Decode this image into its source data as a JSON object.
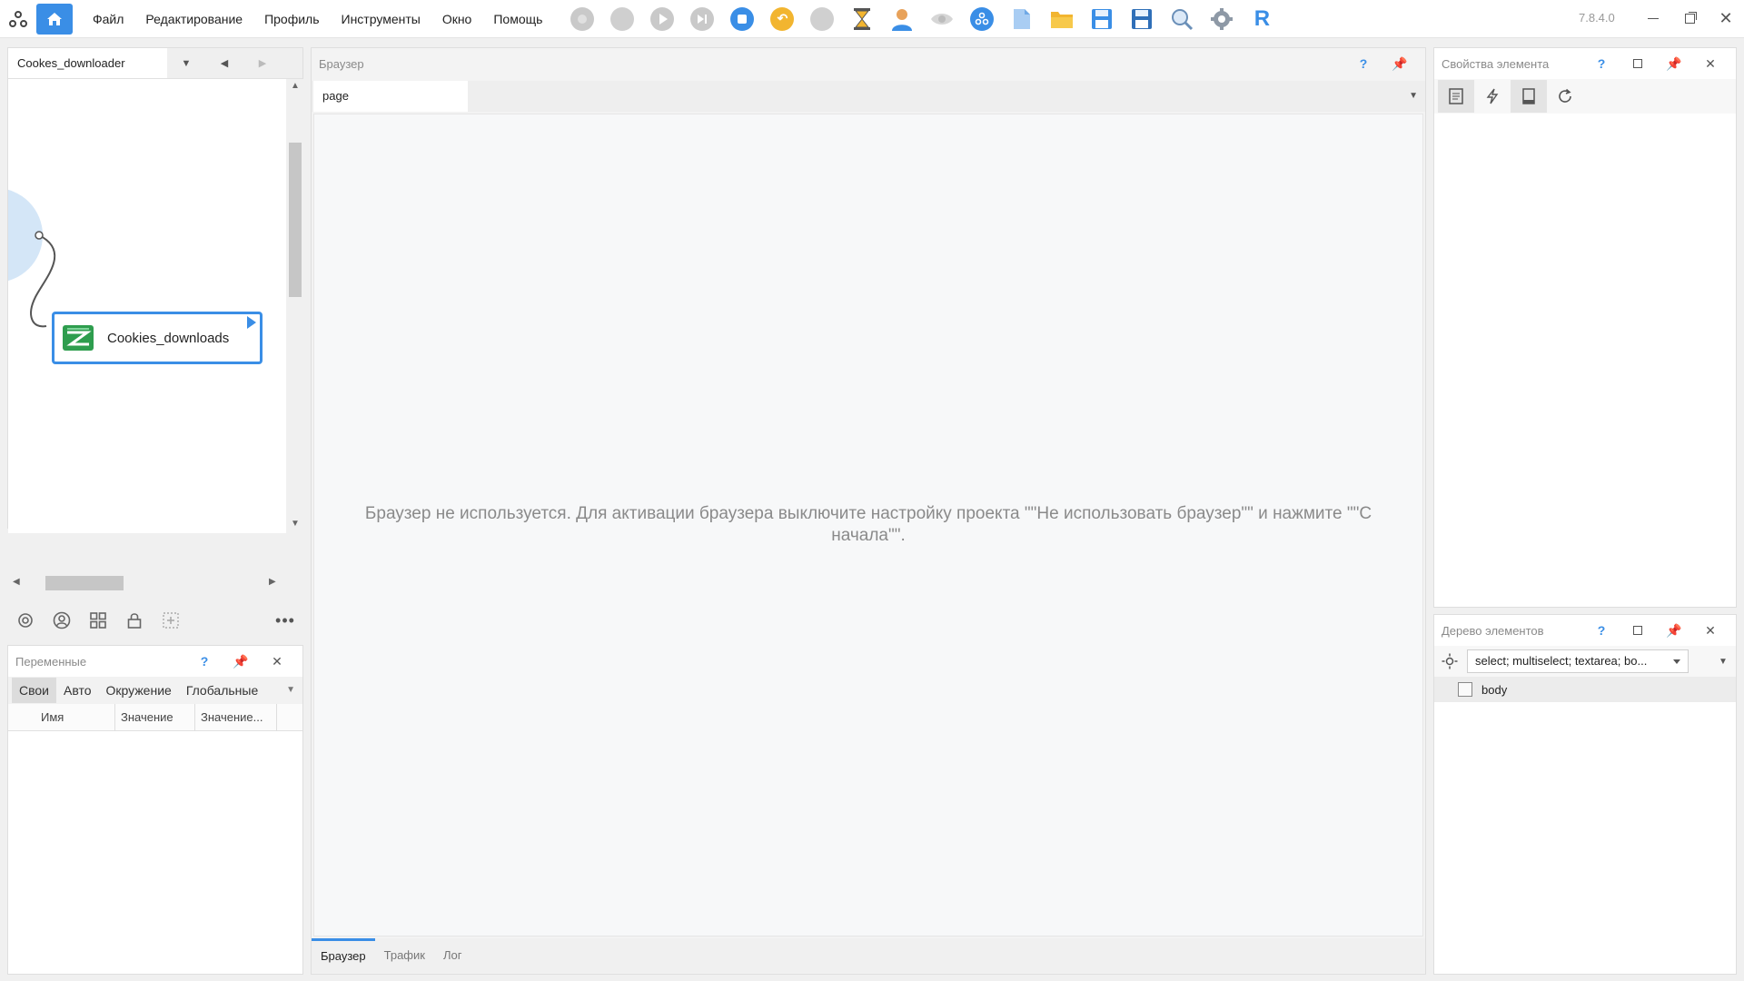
{
  "menu": {
    "items": [
      "Файл",
      "Редактирование",
      "Профиль",
      "Инструменты",
      "Окно",
      "Помощь"
    ]
  },
  "toolbar": {
    "icons": [
      "record-icon",
      "step-icon",
      "play-icon",
      "skip-icon",
      "stop-icon",
      "undo-icon",
      "pause-icon",
      "hourglass-icon",
      "user-icon",
      "eye-icon",
      "network-icon",
      "new-file-icon",
      "open-folder-icon",
      "save-icon",
      "save-as-icon",
      "search-icon",
      "gear-icon",
      "r-icon"
    ]
  },
  "app": {
    "version": "7.8.4.0"
  },
  "project": {
    "tab_label": "Cookes_downloader",
    "node_label": "Cookies_downloads"
  },
  "variables": {
    "title": "Переменные",
    "tabs": [
      "Свои",
      "Авто",
      "Окружение",
      "Глобальные"
    ],
    "columns": [
      "Имя",
      "Значение",
      "Значение..."
    ]
  },
  "browser": {
    "title": "Браузер",
    "page_tab": "page",
    "message": "Браузер не используется. Для активации браузера выключите настройку проекта \"\"Не использовать браузер\"\" и нажмите \"\"С начала\"\".",
    "bottom_tabs": [
      "Браузер",
      "Трафик",
      "Лог"
    ]
  },
  "props": {
    "title": "Свойства элемента"
  },
  "tree": {
    "title": "Дерево элементов",
    "filter": "select; multiselect; textarea; bo...",
    "root": "body"
  },
  "colors": {
    "accent": "#3a8ee6",
    "node_green": "#2e9d4e"
  }
}
